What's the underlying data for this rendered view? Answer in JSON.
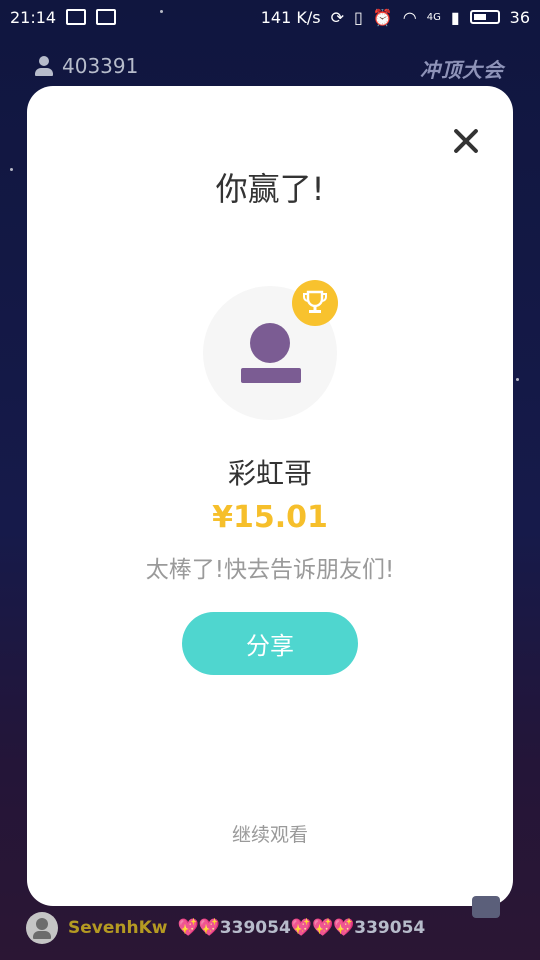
{
  "status_bar": {
    "time": "21:14",
    "speed": "141 K/s",
    "network": "4G",
    "battery": "36"
  },
  "live": {
    "viewer_count": "403391",
    "brand": "冲顶大会"
  },
  "modal": {
    "title": "你赢了!",
    "winner_name": "彩虹哥",
    "prize": "¥15.01",
    "message": "太棒了!快去告诉朋友们!",
    "share_label": "分享",
    "continue_label": "继续观看"
  },
  "chat": {
    "username": "SevenhKw",
    "message": "💖💖339054💖💖💖339054"
  },
  "colors": {
    "accent_teal": "#4fd6cf",
    "prize_gold": "#f6bf2b",
    "avatar_purple": "#7b5c93",
    "background": "#10163f"
  }
}
